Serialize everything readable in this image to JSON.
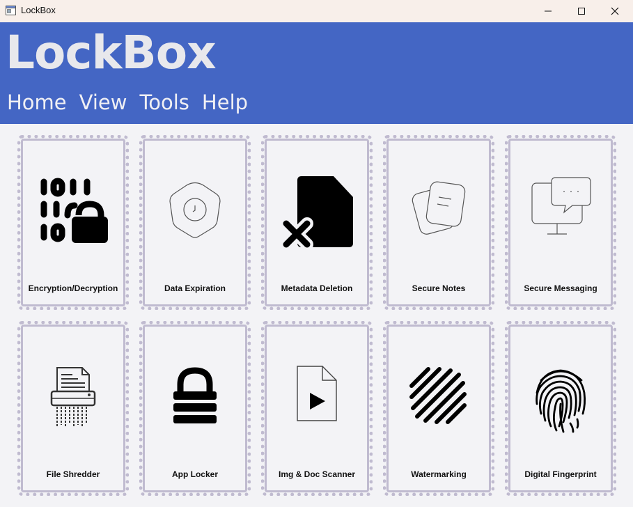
{
  "window": {
    "title": "LockBox",
    "app_icon": "app-window-icon",
    "controls": [
      "minimize-icon",
      "maximize-icon",
      "close-icon"
    ]
  },
  "header": {
    "brand": "LockBox",
    "menu": [
      "Home",
      "View",
      "Tools",
      "Help"
    ],
    "background": "#4466c4"
  },
  "tools": [
    {
      "label": "Encryption/Decryption",
      "icon": "binary-lock-icon"
    },
    {
      "label": "Data Expiration",
      "icon": "shield-clock-icon"
    },
    {
      "label": "Metadata Deletion",
      "icon": "file-delete-icon"
    },
    {
      "label": "Secure Notes",
      "icon": "notes-icon"
    },
    {
      "label": "Secure Messaging",
      "icon": "chat-monitor-icon"
    },
    {
      "label": "File Shredder",
      "icon": "shredder-icon"
    },
    {
      "label": "App Locker",
      "icon": "padlock-icon"
    },
    {
      "label": "Img & Doc Scanner",
      "icon": "file-play-icon"
    },
    {
      "label": "Watermarking",
      "icon": "stripes-icon"
    },
    {
      "label": "Digital Fingerprint",
      "icon": "fingerprint-icon"
    }
  ]
}
